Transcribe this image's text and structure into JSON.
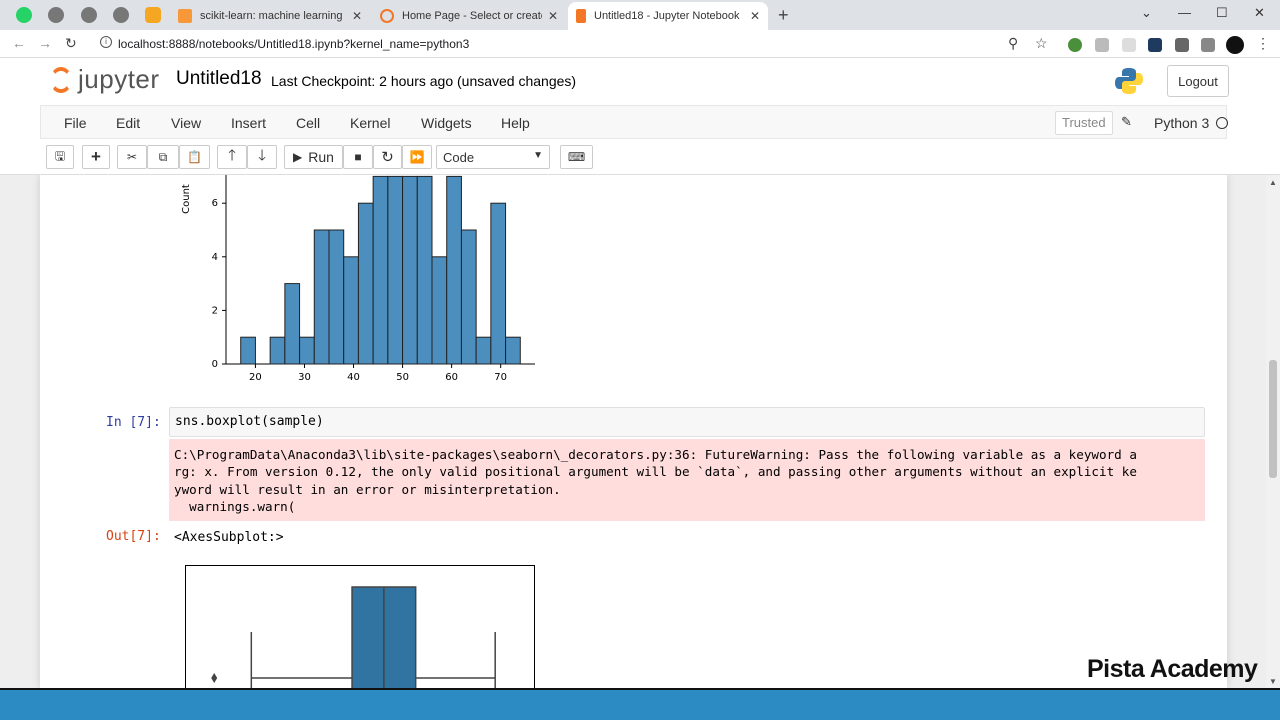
{
  "browser": {
    "tabs": [
      {
        "title": "scikit-learn: machine learning in P",
        "close": "✕"
      },
      {
        "title": "Home Page - Select or create a no",
        "close": "✕"
      },
      {
        "title": "Untitled18 - Jupyter Notebook",
        "close": "✕"
      }
    ],
    "new_tab": "+",
    "url": "localhost:8888/notebooks/Untitled18.ipynb?kernel_name=python3",
    "window_controls": {
      "minimize": "—",
      "maximize": "☐",
      "close": "✕",
      "dropdown": "⌄"
    }
  },
  "jupyter": {
    "logo_text": "jupyter",
    "notebook_name": "Untitled18",
    "checkpoint": "Last Checkpoint: 2 hours ago",
    "unsaved": "(unsaved changes)",
    "logout": "Logout",
    "menu": [
      "File",
      "Edit",
      "View",
      "Insert",
      "Cell",
      "Kernel",
      "Widgets",
      "Help"
    ],
    "trusted": "Trusted",
    "kernel_name": "Python 3",
    "toolbar": {
      "run_label": "Run",
      "cell_type": "Code"
    }
  },
  "cells": {
    "in_prompt": "In [7]:",
    "code": "sns.boxplot(sample)",
    "stderr_lines": [
      "C:\\ProgramData\\Anaconda3\\lib\\site-packages\\seaborn\\_decorators.py:36: FutureWarning: Pass the following variable as a keyword a",
      "rg: x. From version 0.12, the only valid positional argument will be `data`, and passing other arguments without an explicit ke",
      "yword will result in an error or misinterpretation.",
      "  warnings.warn("
    ],
    "out_prompt": "Out[7]:",
    "out_text": "<AxesSubplot:>"
  },
  "chart_data": [
    {
      "type": "bar",
      "ylabel": "Count",
      "xlabel": "",
      "x_ticks": [
        "20",
        "30",
        "40",
        "50",
        "60",
        "70"
      ],
      "y_ticks": [
        "0",
        "2",
        "4",
        "6"
      ],
      "ylim": [
        0,
        7
      ],
      "xlim": [
        14,
        77
      ],
      "bin_edges": [
        17,
        20,
        23,
        26,
        29,
        32,
        35,
        38,
        41,
        44,
        47,
        50,
        53,
        56,
        59,
        62,
        65,
        68,
        71,
        74
      ],
      "values": [
        1,
        0,
        1,
        3,
        1,
        5,
        5,
        4,
        6,
        7,
        7,
        7,
        7,
        4,
        7,
        5,
        1,
        6,
        1
      ],
      "color": "#4c8fbf"
    },
    {
      "type": "boxplot",
      "orientation": "horizontal",
      "q1": 44,
      "median": 50,
      "q3": 56,
      "whisker_low": 25,
      "whisker_high": 71,
      "outliers": [
        18
      ],
      "color": "#3274a1"
    }
  ],
  "watermark": "Pista Academy"
}
